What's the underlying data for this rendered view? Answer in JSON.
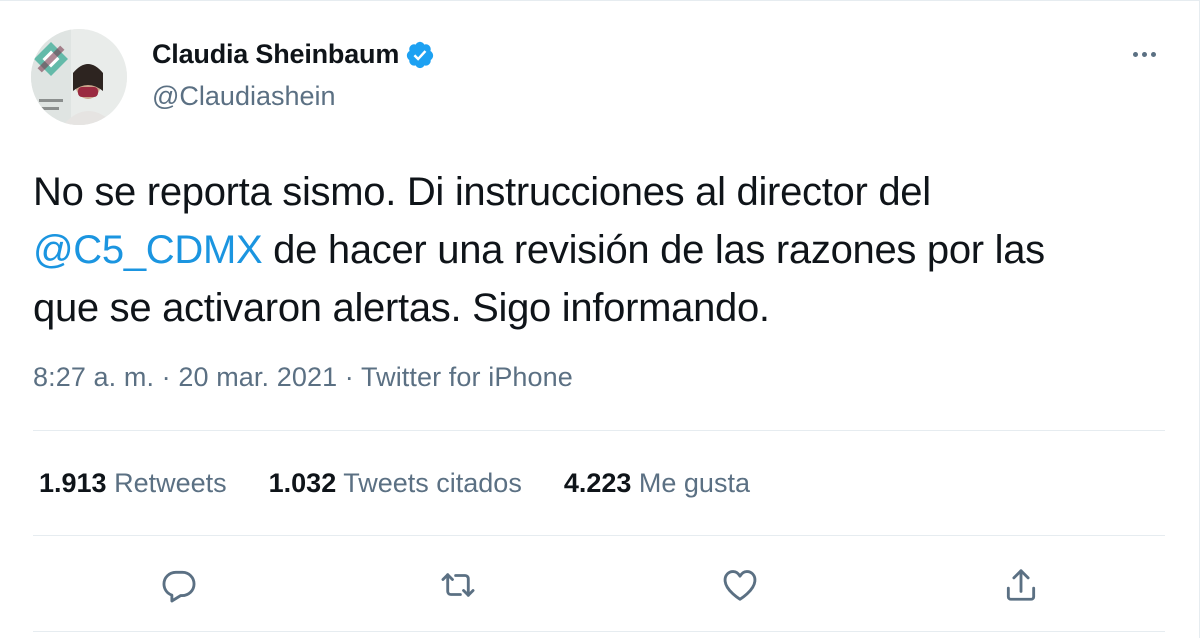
{
  "user": {
    "display_name": "Claudia Sheinbaum",
    "handle": "@Claudiashein",
    "verified": true
  },
  "tweet": {
    "line1": "No se reporta sismo. Di instrucciones al director del",
    "mention": "@C5_CDMX",
    "line2_rest": " de hacer una revisión de las razones por las",
    "line3": "que se activaron alertas. Sigo informando."
  },
  "meta": {
    "time": "8:27 a. m.",
    "separator": " · ",
    "date": "20 mar. 2021",
    "source": "Twitter for iPhone"
  },
  "stats": {
    "retweets_count": "1.913",
    "retweets_label": " Retweets",
    "quotes_count": "1.032",
    "quotes_label": " Tweets citados",
    "likes_count": "4.223",
    "likes_label": " Me gusta"
  },
  "actions": [
    "reply-icon",
    "retweet-icon",
    "like-icon",
    "share-icon"
  ],
  "colors": {
    "text": "#0f1419",
    "secondary": "#5b7083",
    "link": "#1b95e0",
    "verified": "#1da1f2",
    "divider": "#e6ecf0"
  }
}
